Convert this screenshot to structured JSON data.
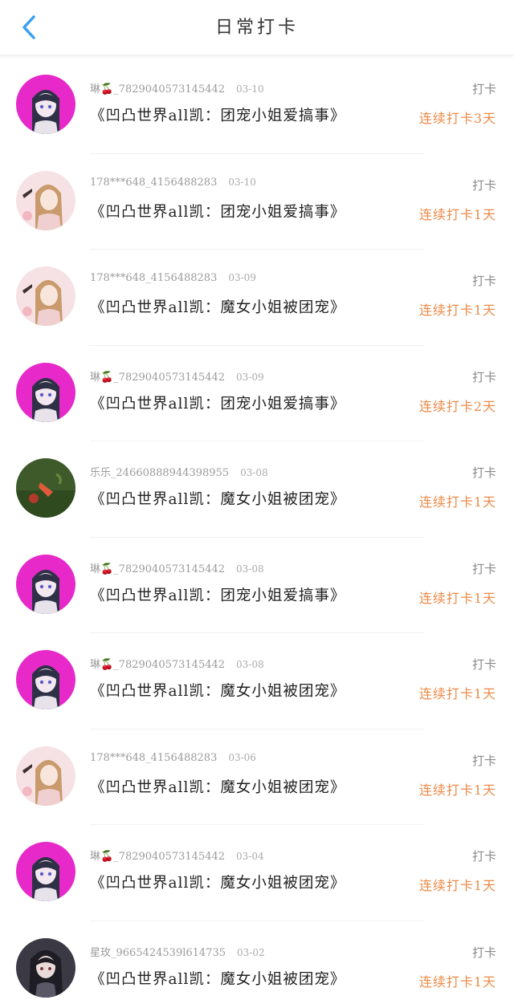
{
  "header": {
    "title": "日常打卡",
    "back_icon": "chevron-left-icon",
    "accent": "#3a9ff5"
  },
  "colors": {
    "streak": "#ec8a47"
  },
  "entries": [
    {
      "user": "琳🍒_7829040573145442",
      "date": "03-10",
      "book": "《凹凸世界all凯：团宠小姐爱搞事》",
      "tag": "打卡",
      "streak": "连续打卡3天",
      "avatar": "anime-girl-magenta"
    },
    {
      "user": "178***648_4156488283",
      "date": "03-10",
      "book": "《凹凸世界all凯：团宠小姐爱搞事》",
      "tag": "打卡",
      "streak": "连续打卡1天",
      "avatar": "anime-girl-blonde"
    },
    {
      "user": "178***648_4156488283",
      "date": "03-09",
      "book": "《凹凸世界all凯：魔女小姐被团宠》",
      "tag": "打卡",
      "streak": "连续打卡1天",
      "avatar": "anime-girl-blonde"
    },
    {
      "user": "琳🍒_7829040573145442",
      "date": "03-09",
      "book": "《凹凸世界all凯：团宠小姐爱搞事》",
      "tag": "打卡",
      "streak": "连续打卡2天",
      "avatar": "anime-girl-magenta"
    },
    {
      "user": "乐乐_24660888944398955",
      "date": "03-08",
      "book": "《凹凸世界all凯：魔女小姐被团宠》",
      "tag": "打卡",
      "streak": "连续打卡1天",
      "avatar": "photo-grass"
    },
    {
      "user": "琳🍒_7829040573145442",
      "date": "03-08",
      "book": "《凹凸世界all凯：团宠小姐爱搞事》",
      "tag": "打卡",
      "streak": "连续打卡1天",
      "avatar": "anime-girl-magenta"
    },
    {
      "user": "琳🍒_7829040573145442",
      "date": "03-08",
      "book": "《凹凸世界all凯：魔女小姐被团宠》",
      "tag": "打卡",
      "streak": "连续打卡1天",
      "avatar": "anime-girl-magenta"
    },
    {
      "user": "178***648_4156488283",
      "date": "03-06",
      "book": "《凹凸世界all凯：魔女小姐被团宠》",
      "tag": "打卡",
      "streak": "连续打卡1天",
      "avatar": "anime-girl-blonde"
    },
    {
      "user": "琳🍒_7829040573145442",
      "date": "03-04",
      "book": "《凹凸世界all凯：魔女小姐被团宠》",
      "tag": "打卡",
      "streak": "连续打卡1天",
      "avatar": "anime-girl-magenta"
    },
    {
      "user": "星玫_9665424539l614735",
      "date": "03-02",
      "book": "《凹凸世界all凯：魔女小姐被团宠》",
      "tag": "打卡",
      "streak": "连续打卡1天",
      "avatar": "anime-girl-dark"
    }
  ]
}
